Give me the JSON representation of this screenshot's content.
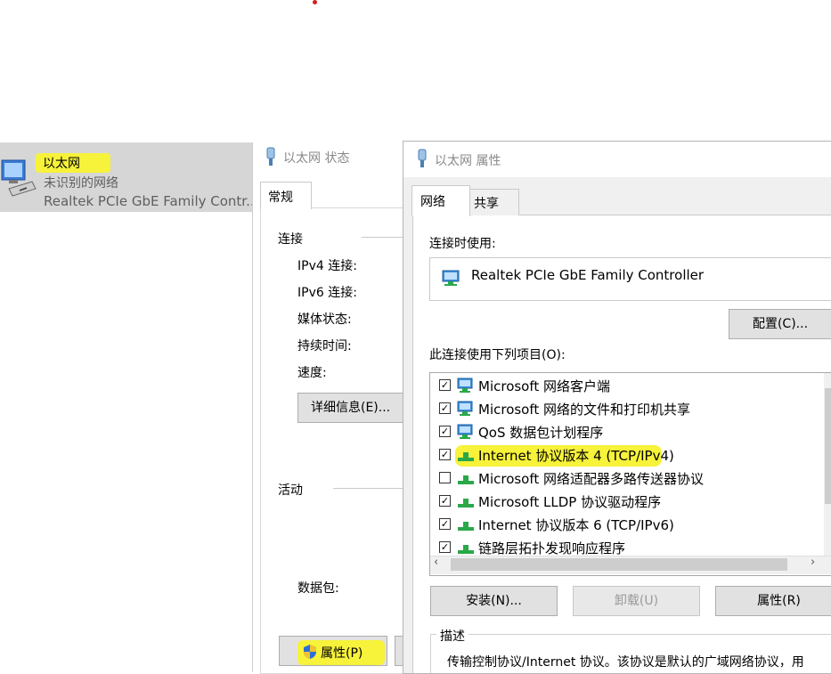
{
  "network_list": {
    "name": "以太网",
    "status": "未识别的网络",
    "adapter": "Realtek PCIe GbE Family Contr..."
  },
  "status_dialog": {
    "title": "以太网 状态",
    "tab": "常规",
    "connection_group": "连接",
    "fields": [
      {
        "label": "IPv4 连接:"
      },
      {
        "label": "IPv6 连接:"
      },
      {
        "label": "媒体状态:"
      },
      {
        "label": "持续时间:"
      },
      {
        "label": "速度:"
      }
    ],
    "details_button": "详细信息(E)...",
    "activity_group": "活动",
    "packets_label": "数据包:",
    "properties_button": "属性(P)"
  },
  "properties_dialog": {
    "title": "以太网 属性",
    "tabs": [
      "网络",
      "共享"
    ],
    "connect_using_label": "连接时使用:",
    "adapter_name": "Realtek PCIe GbE Family Controller",
    "configure_button": "配置(C)...",
    "items_label": "此连接使用下列项目(O):",
    "items": [
      {
        "checked": true,
        "label": "Microsoft 网络客户端",
        "icon": "network-client-icon"
      },
      {
        "checked": true,
        "label": "Microsoft 网络的文件和打印机共享",
        "icon": "network-client-icon"
      },
      {
        "checked": true,
        "label": "QoS 数据包计划程序",
        "icon": "network-client-icon"
      },
      {
        "checked": true,
        "label": "Internet 协议版本 4 (TCP/IPv4)",
        "icon": "protocol-icon"
      },
      {
        "checked": false,
        "label": "Microsoft 网络适配器多路传送器协议",
        "icon": "protocol-icon"
      },
      {
        "checked": true,
        "label": "Microsoft LLDP 协议驱动程序",
        "icon": "protocol-icon"
      },
      {
        "checked": true,
        "label": "Internet 协议版本 6 (TCP/IPv6)",
        "icon": "protocol-icon"
      },
      {
        "checked": true,
        "label": "链路层拓扑发现响应程序",
        "icon": "protocol-icon"
      }
    ],
    "install_button": "安装(N)...",
    "uninstall_button": "卸载(U)",
    "properties_button": "属性(R)",
    "description_group": "描述",
    "description_text": "传输控制协议/Internet 协议。该协议是默认的广域网络协议，用"
  },
  "colors": {
    "highlight": "#f7f23a",
    "selection_bg": "#d6d6d6",
    "dialog_bg": "#f0f0f0",
    "button_bg": "#e1e1e1",
    "muted_text": "#8a8a8a"
  }
}
